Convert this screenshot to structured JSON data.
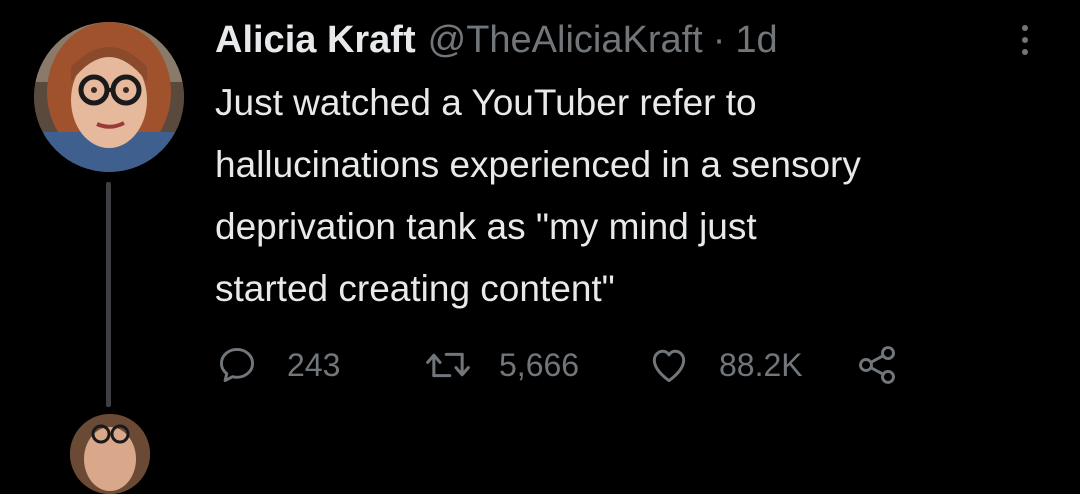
{
  "tweet": {
    "display_name": "Alicia Kraft",
    "handle": "@TheAliciaKraft",
    "separator": "·",
    "time": "1d",
    "text_lines": [
      "Just watched a YouTuber refer to",
      "hallucinations experienced in a sensory",
      "deprivation tank as \"my mind just",
      "started creating content\""
    ]
  },
  "actions": {
    "replies": "243",
    "retweets": "5,666",
    "likes": "88.2K"
  },
  "icons": {
    "more": "more-vertical-icon",
    "reply": "reply-icon",
    "retweet": "retweet-icon",
    "like": "heart-icon",
    "share": "share-icon"
  },
  "colors": {
    "background": "#000000",
    "text": "#e7e9ea",
    "secondary": "#71767b",
    "thread_line": "#3d3f42"
  }
}
